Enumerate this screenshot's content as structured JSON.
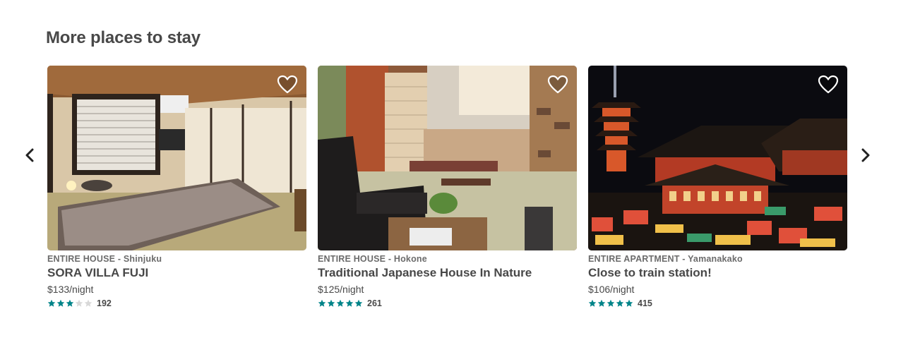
{
  "section": {
    "title": "More places to stay"
  },
  "colors": {
    "star_filled": "#008489",
    "star_empty": "#d8d8d8",
    "text": "#484848",
    "meta": "#6b6b6b"
  },
  "listings": [
    {
      "meta": "ENTIRE HOUSE - Shinjuku",
      "name": "SORA VILLA FUJI",
      "price": "$133/night",
      "rating_stars": 3,
      "reviews": "192"
    },
    {
      "meta": "ENTIRE HOUSE - Hokone",
      "name": "Traditional Japanese House In Nature",
      "price": "$125/night",
      "rating_stars": 5,
      "reviews": "261"
    },
    {
      "meta": "ENTIRE APARTMENT - Yamanakako",
      "name": "Close to train station!",
      "price": "$106/night",
      "rating_stars": 5,
      "reviews": "415"
    }
  ],
  "icons": {
    "prev": "chevron-left-icon",
    "next": "chevron-right-icon",
    "favorite": "heart-outline-icon",
    "star": "star-icon"
  }
}
